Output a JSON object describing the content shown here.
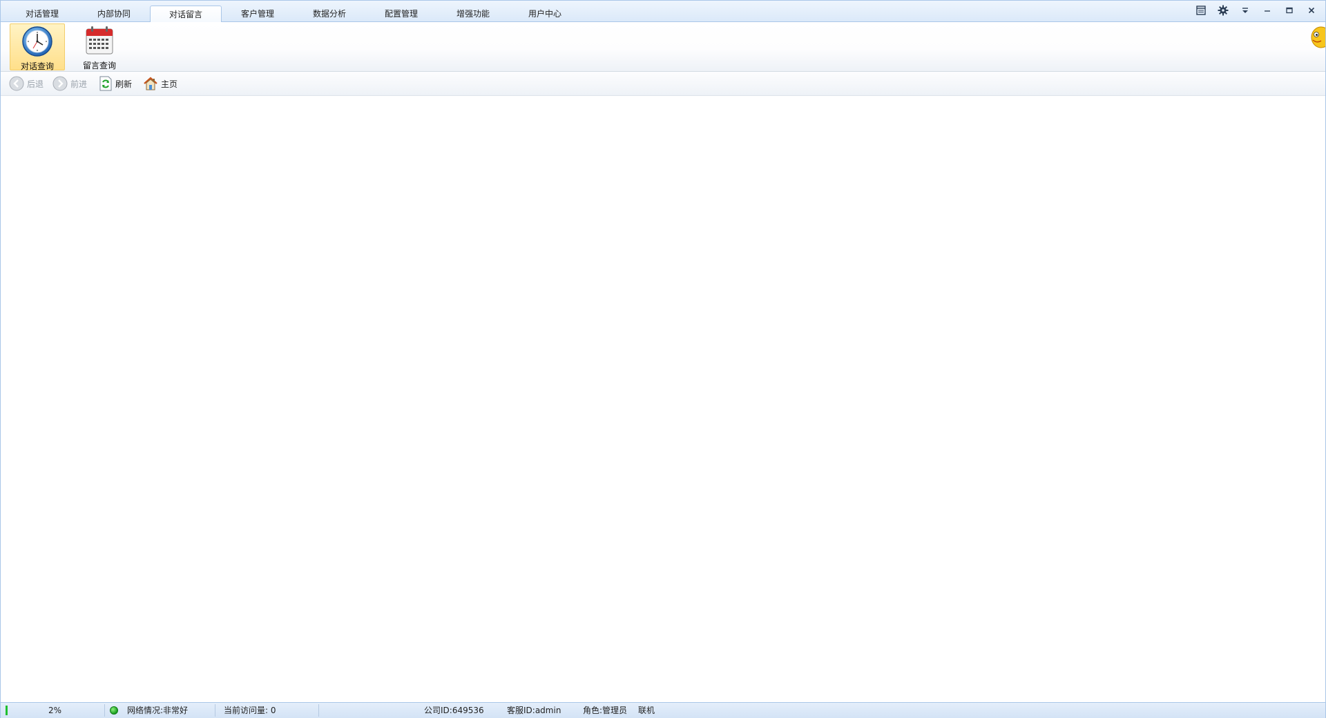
{
  "tabs": [
    {
      "label": "对话管理",
      "active": false
    },
    {
      "label": "内部协同",
      "active": false
    },
    {
      "label": "对话留言",
      "active": true
    },
    {
      "label": "客户管理",
      "active": false
    },
    {
      "label": "数据分析",
      "active": false
    },
    {
      "label": "配置管理",
      "active": false
    },
    {
      "label": "增强功能",
      "active": false
    },
    {
      "label": "用户中心",
      "active": false
    }
  ],
  "window_controls": [
    "layout-icon",
    "gear-icon",
    "dropdown-icon",
    "minimize-icon",
    "maximize-icon",
    "close-icon"
  ],
  "ribbon": {
    "items": [
      {
        "label": "对话查询",
        "icon": "clock-icon",
        "selected": true
      },
      {
        "label": "留言查询",
        "icon": "calendar-icon",
        "selected": false
      }
    ]
  },
  "nav": {
    "back_label": "后退",
    "forward_label": "前进",
    "refresh_label": "刷新",
    "home_label": "主页"
  },
  "status": {
    "progress": "2%",
    "network": "网络情况:非常好",
    "visits": "当前访问量: 0",
    "company_id": "公司ID:649536",
    "agent_id": "客服ID:admin",
    "role": "角色:管理员",
    "connection": "联机"
  },
  "colors": {
    "tab_border": "#a9c6e8",
    "ribbon_selected": "#ffdf8a",
    "status_green": "#1fbf2e"
  }
}
